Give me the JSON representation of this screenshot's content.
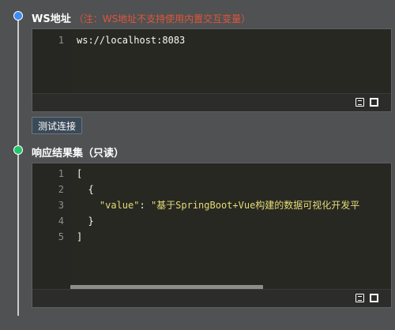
{
  "ws_section": {
    "title": "WS地址",
    "note": "（注：WS地址不支持使用内置交互变量）",
    "editor": {
      "line_numbers": [
        "1"
      ],
      "lines": [
        "ws://localhost:8083"
      ]
    }
  },
  "test_button": {
    "label": "测试连接"
  },
  "result_section": {
    "title": "响应结果集（只读）",
    "editor": {
      "line_numbers": [
        "1",
        "2",
        "3",
        "4",
        "5"
      ],
      "lines": [
        "[",
        "  {",
        "    \"value\": \"基于SpringBoot+Vue构建的数据可视化开发平",
        "  }",
        "]"
      ],
      "value_key": "\"value\"",
      "value_text": "\"基于SpringBoot+Vue构建的数据可视化开发平",
      "scroll_fraction": 0.6
    }
  },
  "colors": {
    "background": "#505152",
    "editor_bg": "#272822",
    "note": "#e0553b",
    "blue_dot": "#3d8cf5",
    "green_dot": "#25c46a",
    "string": "#e6db74"
  },
  "icons": [
    "copy-icon",
    "fullscreen-icon"
  ]
}
